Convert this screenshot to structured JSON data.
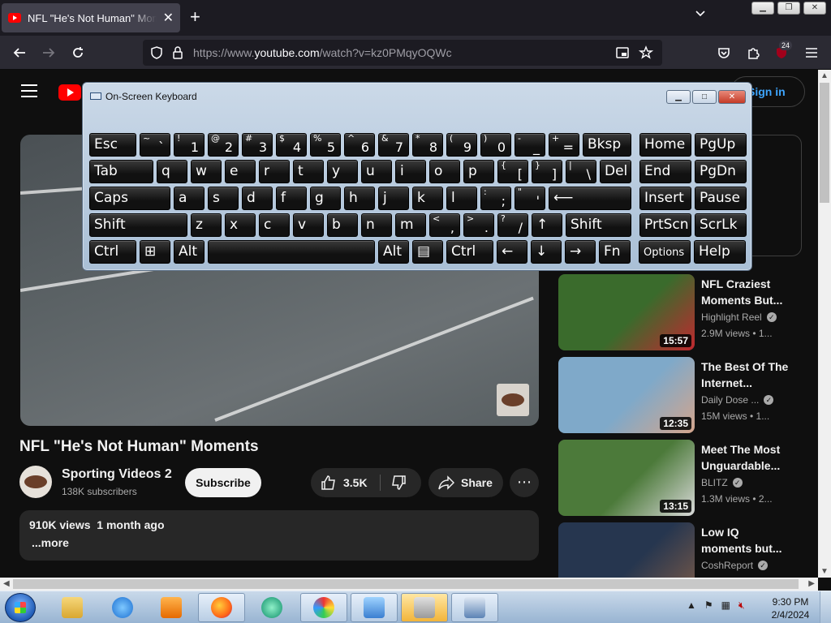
{
  "browser": {
    "tab_title": "NFL \"He's Not Human\" Moments",
    "url_prefix": "https://www.",
    "url_domain": "youtube.com",
    "url_path": "/watch?v=kz0PMqyOQWc",
    "extensions_badge": "24"
  },
  "youtube": {
    "signin_label": "Sign in",
    "video_title": "NFL \"He's Not Human\" Moments",
    "channel_name": "Sporting Videos 2",
    "subscribers": "138K subscribers",
    "subscribe_label": "Subscribe",
    "likes": "3.5K",
    "share_label": "Share",
    "views": "910K views",
    "age": "1 month ago",
    "more_label": "...more",
    "suggestions": [
      {
        "title": "NFL Craziest Moments But...",
        "channel": "Highlight Reel",
        "meta": "2.9M views  • 1...",
        "duration": "15:57",
        "colors": [
          "#3a6b2c",
          "#c1282f"
        ]
      },
      {
        "title": "The Best Of The Internet...",
        "channel": "Daily Dose ...",
        "meta": "15M views  • 1...",
        "duration": "12:35",
        "colors": [
          "#7fa9c9",
          "#d4a58c"
        ]
      },
      {
        "title": "Meet The Most Unguardable...",
        "channel": "BLITZ",
        "meta": "1.3M views  • 2...",
        "duration": "13:15",
        "colors": [
          "#4c7a3a",
          "#d9d9d9"
        ]
      },
      {
        "title": "Low IQ moments but...",
        "channel": "CoshReport",
        "meta": "",
        "duration": "",
        "colors": [
          "#26364f",
          "#7a5a48"
        ]
      }
    ]
  },
  "osk": {
    "title": "On-Screen Keyboard",
    "rows": [
      [
        {
          "l": "Esc",
          "w": 58
        },
        {
          "s": "~",
          "l": "`",
          "w": 38
        },
        {
          "s": "!",
          "l": "1",
          "w": 38
        },
        {
          "s": "@",
          "l": "2",
          "w": 38
        },
        {
          "s": "#",
          "l": "3",
          "w": 38
        },
        {
          "s": "$",
          "l": "4",
          "w": 38
        },
        {
          "s": "%",
          "l": "5",
          "w": 38
        },
        {
          "s": "^",
          "l": "6",
          "w": 38
        },
        {
          "s": "&",
          "l": "7",
          "w": 38
        },
        {
          "s": "*",
          "l": "8",
          "w": 38
        },
        {
          "s": "(",
          "l": "9",
          "w": 38
        },
        {
          "s": ")",
          "l": "0",
          "w": 38
        },
        {
          "s": "-",
          "l": "_",
          "w": 38
        },
        {
          "s": "+",
          "l": "=",
          "w": 38
        },
        {
          "l": "Bksp",
          "w": 60
        },
        {
          "gap": 6
        },
        {
          "l": "Home",
          "w": 64
        },
        {
          "l": "PgUp",
          "w": 64
        }
      ],
      [
        {
          "l": "Tab",
          "w": 79
        },
        {
          "l": "q",
          "w": 38
        },
        {
          "l": "w",
          "w": 38
        },
        {
          "l": "e",
          "w": 38
        },
        {
          "l": "r",
          "w": 38
        },
        {
          "l": "t",
          "w": 38
        },
        {
          "l": "y",
          "w": 38
        },
        {
          "l": "u",
          "w": 38
        },
        {
          "l": "i",
          "w": 38
        },
        {
          "l": "o",
          "w": 38
        },
        {
          "l": "p",
          "w": 38
        },
        {
          "s": "{",
          "l": "[",
          "w": 38
        },
        {
          "s": "}",
          "l": "]",
          "w": 38
        },
        {
          "s": "|",
          "l": "\\",
          "w": 38
        },
        {
          "l": "Del",
          "w": 39
        },
        {
          "gap": 6
        },
        {
          "l": "End",
          "w": 64
        },
        {
          "l": "PgDn",
          "w": 64
        }
      ],
      [
        {
          "l": "Caps",
          "w": 100
        },
        {
          "l": "a",
          "w": 38
        },
        {
          "l": "s",
          "w": 38
        },
        {
          "l": "d",
          "w": 38
        },
        {
          "l": "f",
          "w": 38
        },
        {
          "l": "g",
          "w": 38
        },
        {
          "l": "h",
          "w": 38
        },
        {
          "l": "j",
          "w": 38
        },
        {
          "l": "k",
          "w": 38
        },
        {
          "l": "l",
          "w": 38
        },
        {
          "s": ":",
          "l": ";",
          "w": 38
        },
        {
          "s": "\"",
          "l": "'",
          "w": 38
        },
        {
          "l": "⟵",
          "w": 102
        },
        {
          "gap": 6
        },
        {
          "l": "Insert",
          "w": 64
        },
        {
          "l": "Pause",
          "w": 64
        }
      ],
      [
        {
          "l": "Shift",
          "w": 121
        },
        {
          "l": "z",
          "w": 38
        },
        {
          "l": "x",
          "w": 38
        },
        {
          "l": "c",
          "w": 38
        },
        {
          "l": "v",
          "w": 38
        },
        {
          "l": "b",
          "w": 38
        },
        {
          "l": "n",
          "w": 38
        },
        {
          "l": "m",
          "w": 38
        },
        {
          "s": "<",
          "l": ",",
          "w": 38
        },
        {
          "s": ">",
          "l": ".",
          "w": 38
        },
        {
          "s": "?",
          "l": "/",
          "w": 38
        },
        {
          "l": "↑",
          "w": 38
        },
        {
          "l": "Shift",
          "w": 81
        },
        {
          "gap": 6
        },
        {
          "l": "PrtScn",
          "w": 64
        },
        {
          "l": "ScrLk",
          "w": 64
        }
      ],
      [
        {
          "l": "Ctrl",
          "w": 58
        },
        {
          "l": "⊞",
          "w": 38
        },
        {
          "l": "Alt",
          "w": 38
        },
        {
          "l": "",
          "w": 206
        },
        {
          "l": "Alt",
          "w": 38
        },
        {
          "l": "▤",
          "w": 38
        },
        {
          "l": "Ctrl",
          "w": 58
        },
        {
          "l": "←",
          "w": 38
        },
        {
          "l": "↓",
          "w": 38
        },
        {
          "l": "→",
          "w": 38
        },
        {
          "l": "Fn",
          "w": 39
        },
        {
          "gap": 6
        },
        {
          "l": "Options",
          "w": 64,
          "small": true
        },
        {
          "l": "Help",
          "w": 64
        }
      ]
    ]
  },
  "taskbar": {
    "time": "9:30 PM",
    "date": "2/4/2024"
  }
}
